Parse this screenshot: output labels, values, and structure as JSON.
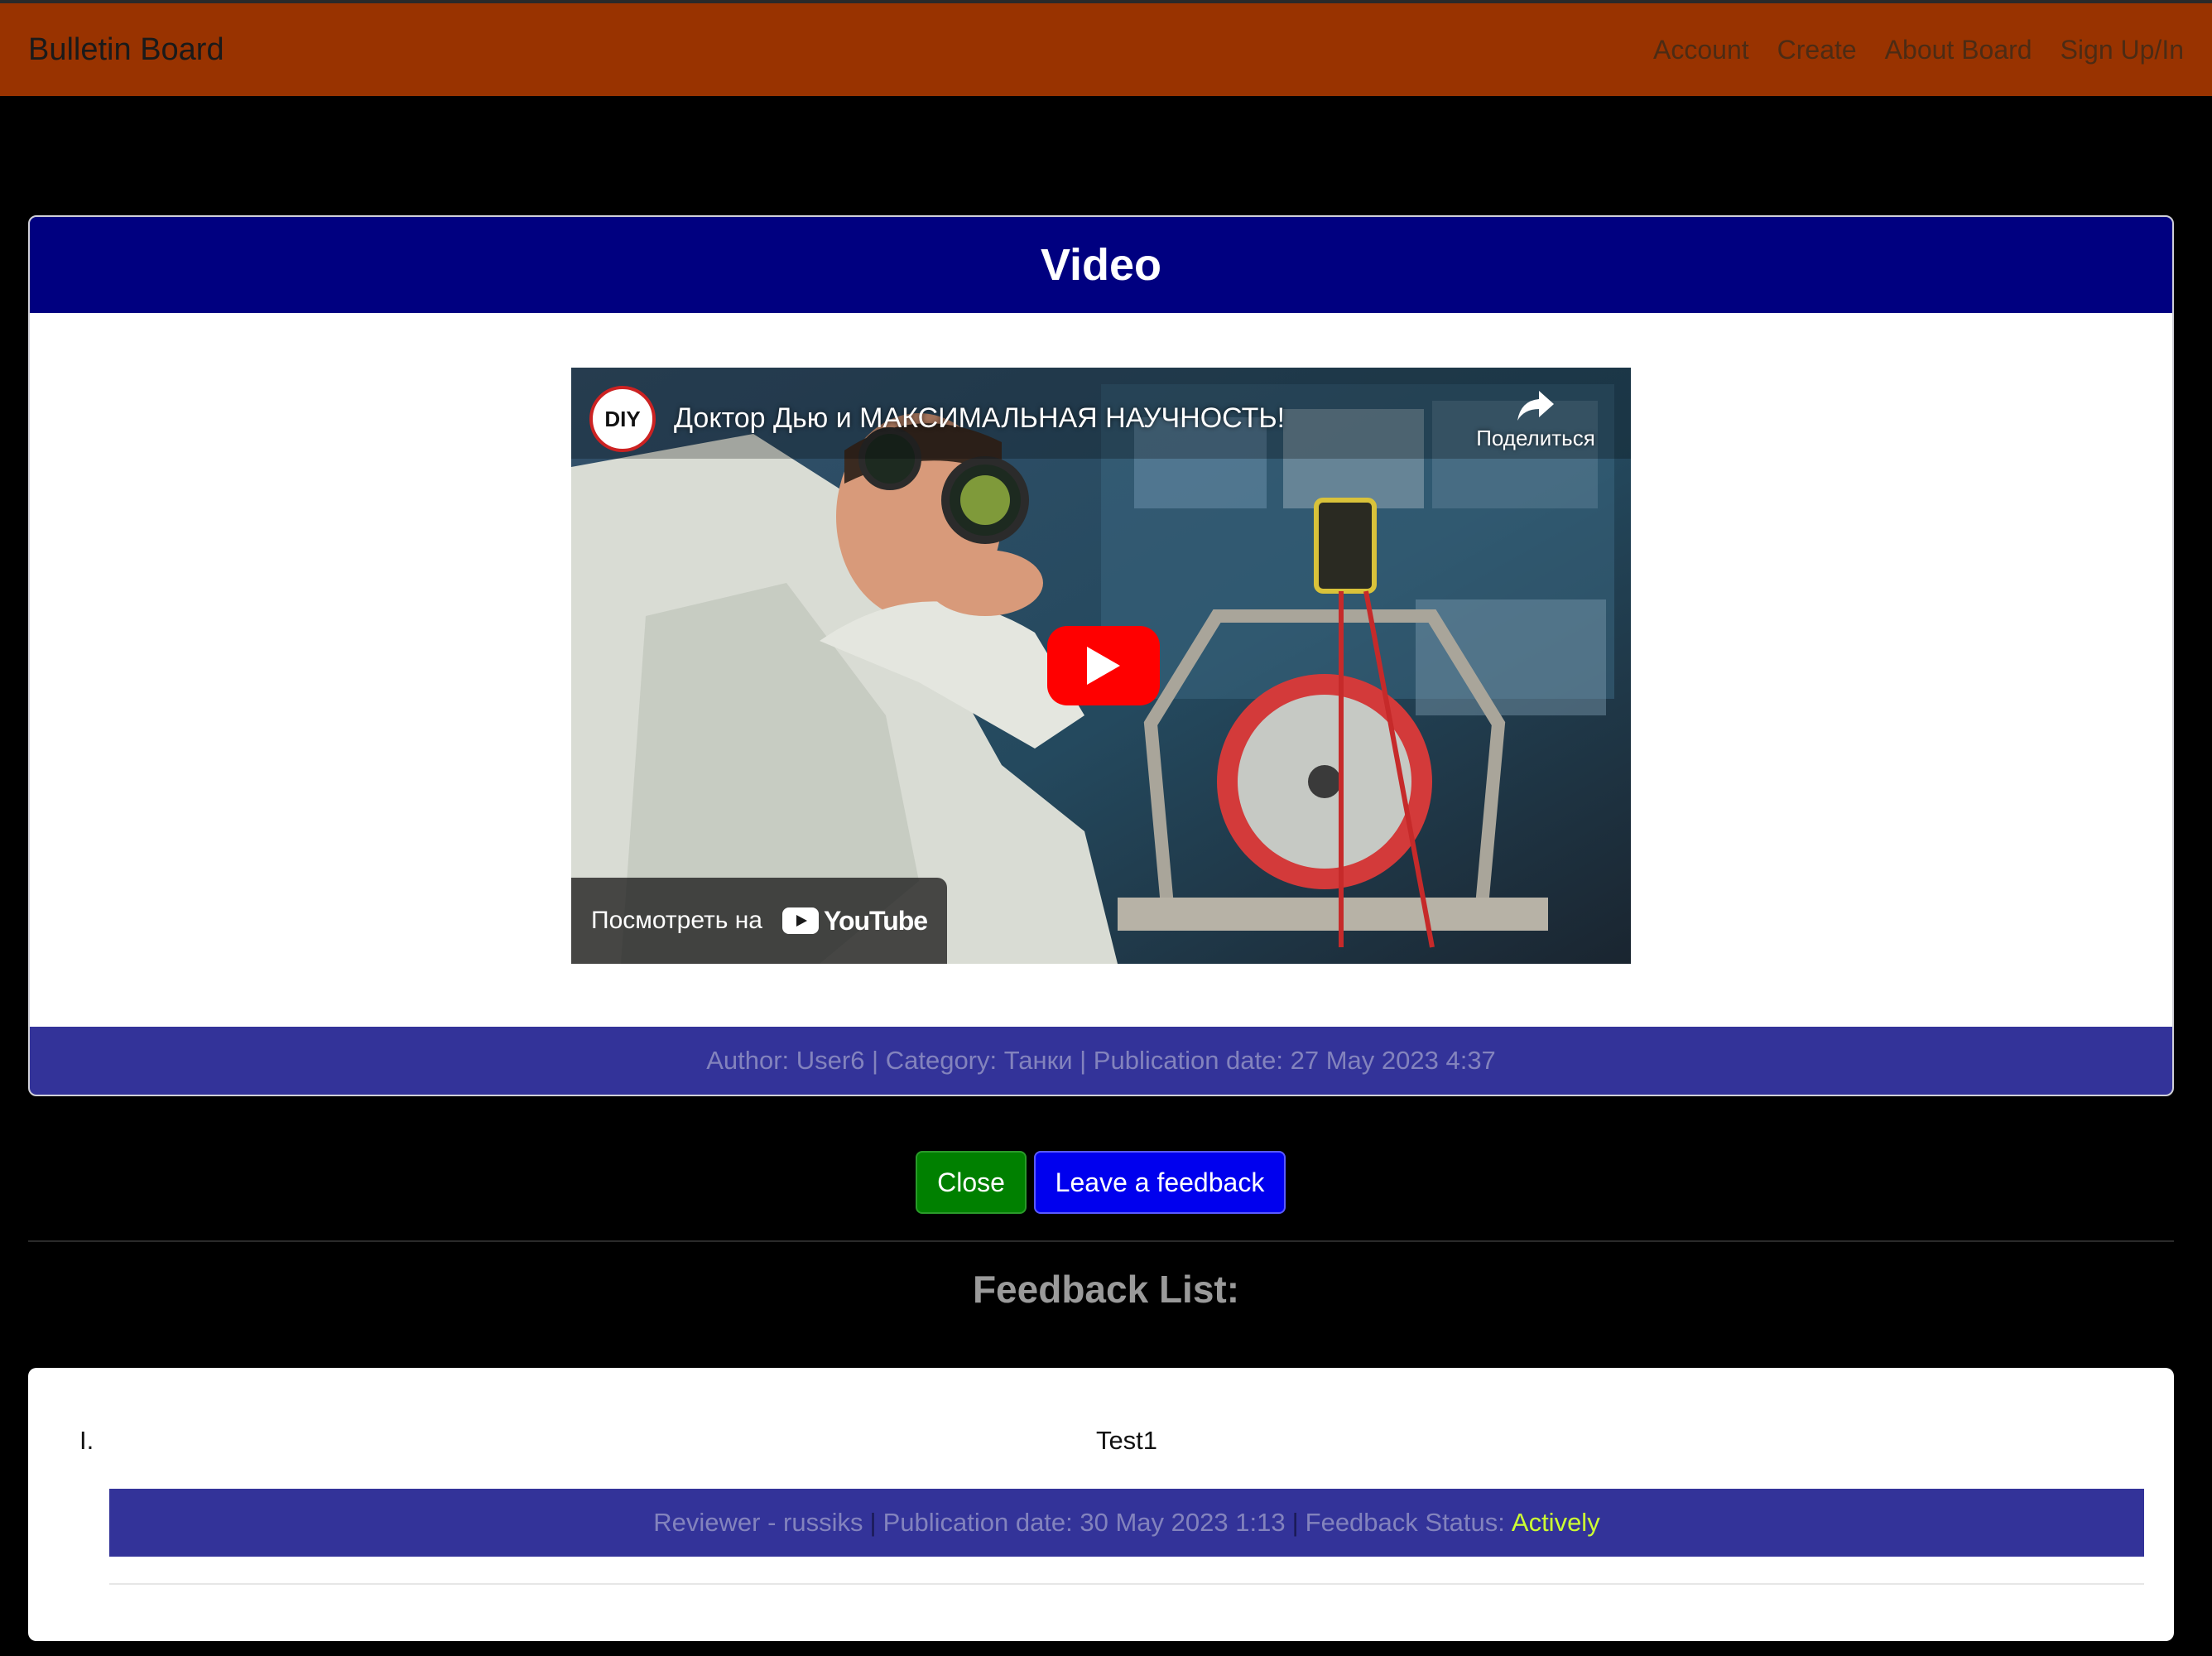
{
  "navbar": {
    "brand": "Bulletin Board",
    "links": [
      "Account",
      "Create",
      "About Board",
      "Sign Up/In"
    ],
    "color": "#993300"
  },
  "card": {
    "title": "Video",
    "header_color": "#000080",
    "footer_color": "#333399",
    "footer": "Author: User6 | Category: Танки | Publication date: 27 May 2023 4:37"
  },
  "video": {
    "channel_logo": "DIY",
    "title": "Доктор Дью и МАКСИМАЛЬНАЯ НАУЧНОСТЬ!",
    "share_label": "Поделиться",
    "watch_on_label": "Посмотреть на",
    "youtube_label": "YouTube",
    "icons": [
      "share-icon",
      "play-icon",
      "youtube-logo-icon"
    ]
  },
  "buttons": {
    "close": "Close",
    "feedback": "Leave a feedback",
    "close_color": "#008000",
    "feedback_color": "#0000ee"
  },
  "feedback": {
    "heading": "Feedback List:",
    "items": [
      {
        "number": "I.",
        "text": "Test1",
        "reviewer": "Reviewer - russiks",
        "date": "Publication date: 30 May 2023 1:13",
        "status_label": "Feedback Status:",
        "status": "Actively",
        "status_color": "#ccff33"
      }
    ]
  }
}
